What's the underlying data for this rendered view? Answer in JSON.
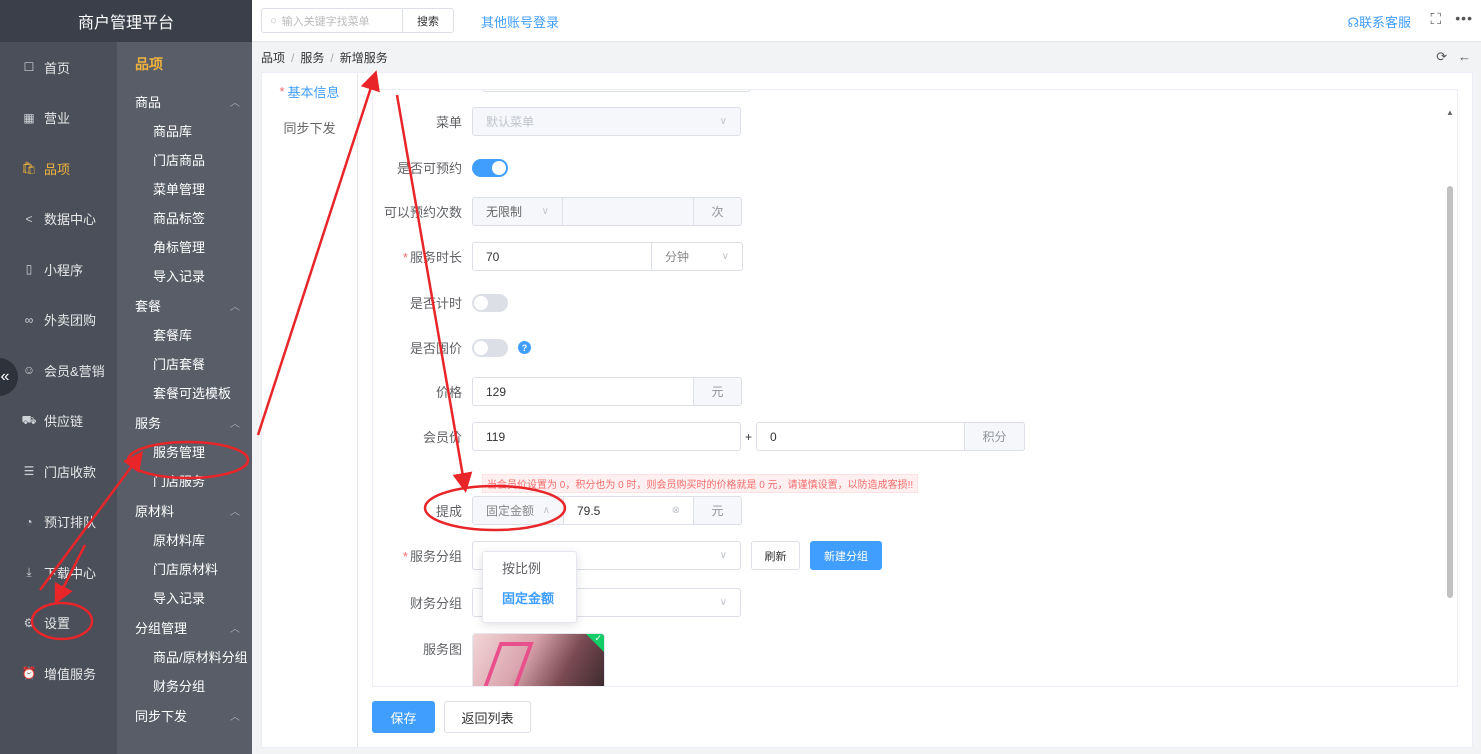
{
  "app": {
    "title": "商户管理平台"
  },
  "topbar": {
    "search_placeholder": "输入关键字找菜单",
    "search_button": "搜索",
    "other_login": "其他账号登录",
    "service": "联系客服",
    "fullscreen_icon": "⛶",
    "more_icon": "•••"
  },
  "sidebar": {
    "collapse_icon": "«",
    "items": [
      {
        "label": "首页",
        "icon": "☐"
      },
      {
        "label": "营业",
        "icon": "▦"
      },
      {
        "label": "品项",
        "icon": "🛍",
        "active": true
      },
      {
        "label": "数据中心",
        "icon": "<"
      },
      {
        "label": "小程序",
        "icon": "▯"
      },
      {
        "label": "外卖团购",
        "icon": "∞"
      },
      {
        "label": "会员&营销",
        "icon": "☺"
      },
      {
        "label": "供应链",
        "icon": "⛟"
      },
      {
        "label": "门店收款",
        "icon": "☰"
      },
      {
        "label": "预订排队",
        "icon": "◔"
      },
      {
        "label": "下载中心",
        "icon": "⤓"
      },
      {
        "label": "设置",
        "icon": "⚙"
      },
      {
        "label": "增值服务",
        "icon": "⏰"
      }
    ]
  },
  "subnav": {
    "title": "品项",
    "groups": [
      {
        "label": "商品",
        "items": [
          "商品库",
          "门店商品",
          "菜单管理",
          "商品标签",
          "角标管理",
          "导入记录"
        ]
      },
      {
        "label": "套餐",
        "items": [
          "套餐库",
          "门店套餐",
          "套餐可选模板"
        ]
      },
      {
        "label": "服务",
        "items": [
          "服务管理",
          "门店服务"
        ]
      },
      {
        "label": "原材料",
        "items": [
          "原材料库",
          "门店原材料",
          "导入记录"
        ]
      },
      {
        "label": "分组管理",
        "items": [
          "商品/原材料分组",
          "财务分组"
        ]
      },
      {
        "label": "同步下发",
        "items": []
      }
    ]
  },
  "breadcrumb": [
    "品项",
    "服务",
    "新增服务"
  ],
  "tabs": [
    {
      "label": "基本信息",
      "required": true
    },
    {
      "label": "同步下发",
      "required": false
    }
  ],
  "form": {
    "menu": {
      "label": "菜单",
      "value": "默认菜单"
    },
    "bookable": {
      "label": "是否可预约",
      "on": true
    },
    "book_times": {
      "label": "可以预约次数",
      "select": "无限制",
      "suffix": "次"
    },
    "duration": {
      "label": "服务时长",
      "value": "70",
      "unit": "分钟"
    },
    "timed": {
      "label": "是否计时",
      "on": false
    },
    "fixed_price": {
      "label": "是否固价",
      "on": false,
      "help": "?"
    },
    "price": {
      "label": "价格",
      "value": "129",
      "suffix": "元"
    },
    "member_price": {
      "label": "会员价",
      "value": "119",
      "plus": "+",
      "points": "0",
      "points_suffix": "积分"
    },
    "member_warning": "当会员价设置为 0，积分也为 0 时，则会员购买时的价格就是 0 元，请谨慎设置，以防造成客损!!",
    "commission": {
      "label": "提成",
      "mode": "固定金额",
      "value": "79.5",
      "suffix": "元"
    },
    "commission_options": [
      "按比例",
      "固定金额"
    ],
    "service_group": {
      "label": "服务分组",
      "refresh": "刷新",
      "new_group": "新建分组"
    },
    "finance_group": {
      "label": "财务分组"
    },
    "image": {
      "label": "服务图"
    }
  },
  "footer": {
    "save": "保存",
    "back": "返回列表"
  },
  "colors": {
    "primary": "#409eff",
    "accent": "#f0b23c",
    "annotation": "#e8262a"
  }
}
